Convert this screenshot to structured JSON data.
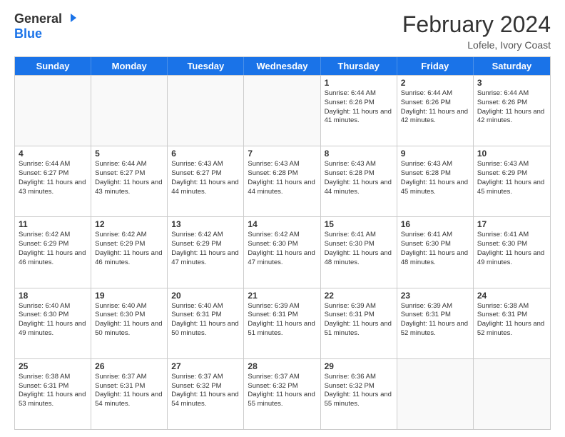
{
  "logo": {
    "general": "General",
    "blue": "Blue"
  },
  "header": {
    "month_year": "February 2024",
    "location": "Lofele, Ivory Coast"
  },
  "days_of_week": [
    "Sunday",
    "Monday",
    "Tuesday",
    "Wednesday",
    "Thursday",
    "Friday",
    "Saturday"
  ],
  "weeks": [
    [
      {
        "day": "",
        "info": ""
      },
      {
        "day": "",
        "info": ""
      },
      {
        "day": "",
        "info": ""
      },
      {
        "day": "",
        "info": ""
      },
      {
        "day": "1",
        "info": "Sunrise: 6:44 AM\nSunset: 6:26 PM\nDaylight: 11 hours and 41 minutes."
      },
      {
        "day": "2",
        "info": "Sunrise: 6:44 AM\nSunset: 6:26 PM\nDaylight: 11 hours and 42 minutes."
      },
      {
        "day": "3",
        "info": "Sunrise: 6:44 AM\nSunset: 6:26 PM\nDaylight: 11 hours and 42 minutes."
      }
    ],
    [
      {
        "day": "4",
        "info": "Sunrise: 6:44 AM\nSunset: 6:27 PM\nDaylight: 11 hours and 43 minutes."
      },
      {
        "day": "5",
        "info": "Sunrise: 6:44 AM\nSunset: 6:27 PM\nDaylight: 11 hours and 43 minutes."
      },
      {
        "day": "6",
        "info": "Sunrise: 6:43 AM\nSunset: 6:27 PM\nDaylight: 11 hours and 44 minutes."
      },
      {
        "day": "7",
        "info": "Sunrise: 6:43 AM\nSunset: 6:28 PM\nDaylight: 11 hours and 44 minutes."
      },
      {
        "day": "8",
        "info": "Sunrise: 6:43 AM\nSunset: 6:28 PM\nDaylight: 11 hours and 44 minutes."
      },
      {
        "day": "9",
        "info": "Sunrise: 6:43 AM\nSunset: 6:28 PM\nDaylight: 11 hours and 45 minutes."
      },
      {
        "day": "10",
        "info": "Sunrise: 6:43 AM\nSunset: 6:29 PM\nDaylight: 11 hours and 45 minutes."
      }
    ],
    [
      {
        "day": "11",
        "info": "Sunrise: 6:42 AM\nSunset: 6:29 PM\nDaylight: 11 hours and 46 minutes."
      },
      {
        "day": "12",
        "info": "Sunrise: 6:42 AM\nSunset: 6:29 PM\nDaylight: 11 hours and 46 minutes."
      },
      {
        "day": "13",
        "info": "Sunrise: 6:42 AM\nSunset: 6:29 PM\nDaylight: 11 hours and 47 minutes."
      },
      {
        "day": "14",
        "info": "Sunrise: 6:42 AM\nSunset: 6:30 PM\nDaylight: 11 hours and 47 minutes."
      },
      {
        "day": "15",
        "info": "Sunrise: 6:41 AM\nSunset: 6:30 PM\nDaylight: 11 hours and 48 minutes."
      },
      {
        "day": "16",
        "info": "Sunrise: 6:41 AM\nSunset: 6:30 PM\nDaylight: 11 hours and 48 minutes."
      },
      {
        "day": "17",
        "info": "Sunrise: 6:41 AM\nSunset: 6:30 PM\nDaylight: 11 hours and 49 minutes."
      }
    ],
    [
      {
        "day": "18",
        "info": "Sunrise: 6:40 AM\nSunset: 6:30 PM\nDaylight: 11 hours and 49 minutes."
      },
      {
        "day": "19",
        "info": "Sunrise: 6:40 AM\nSunset: 6:30 PM\nDaylight: 11 hours and 50 minutes."
      },
      {
        "day": "20",
        "info": "Sunrise: 6:40 AM\nSunset: 6:31 PM\nDaylight: 11 hours and 50 minutes."
      },
      {
        "day": "21",
        "info": "Sunrise: 6:39 AM\nSunset: 6:31 PM\nDaylight: 11 hours and 51 minutes."
      },
      {
        "day": "22",
        "info": "Sunrise: 6:39 AM\nSunset: 6:31 PM\nDaylight: 11 hours and 51 minutes."
      },
      {
        "day": "23",
        "info": "Sunrise: 6:39 AM\nSunset: 6:31 PM\nDaylight: 11 hours and 52 minutes."
      },
      {
        "day": "24",
        "info": "Sunrise: 6:38 AM\nSunset: 6:31 PM\nDaylight: 11 hours and 52 minutes."
      }
    ],
    [
      {
        "day": "25",
        "info": "Sunrise: 6:38 AM\nSunset: 6:31 PM\nDaylight: 11 hours and 53 minutes."
      },
      {
        "day": "26",
        "info": "Sunrise: 6:37 AM\nSunset: 6:31 PM\nDaylight: 11 hours and 54 minutes."
      },
      {
        "day": "27",
        "info": "Sunrise: 6:37 AM\nSunset: 6:32 PM\nDaylight: 11 hours and 54 minutes."
      },
      {
        "day": "28",
        "info": "Sunrise: 6:37 AM\nSunset: 6:32 PM\nDaylight: 11 hours and 55 minutes."
      },
      {
        "day": "29",
        "info": "Sunrise: 6:36 AM\nSunset: 6:32 PM\nDaylight: 11 hours and 55 minutes."
      },
      {
        "day": "",
        "info": ""
      },
      {
        "day": "",
        "info": ""
      }
    ]
  ],
  "accent_color": "#1a73e8"
}
